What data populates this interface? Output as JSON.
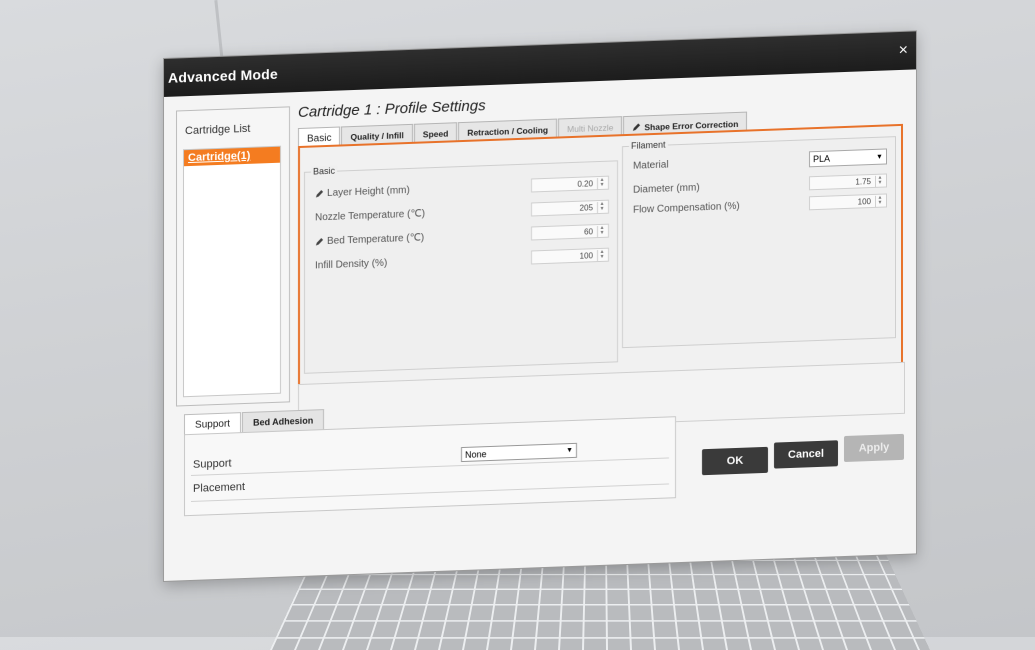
{
  "window": {
    "title": "Advanced Mode",
    "close_glyph": "×"
  },
  "cartridge_list": {
    "header": "Cartridge List",
    "items": [
      "Cartridge(1)"
    ]
  },
  "profile": {
    "title": "Cartridge 1 : Profile Settings"
  },
  "tabs": [
    "Basic",
    "Quality / Infill",
    "Speed",
    "Retraction / Cooling",
    "Multi Nozzle",
    "Shape Error Correction"
  ],
  "basic_group": {
    "label": "Basic",
    "rows": [
      {
        "label": "Layer Height (mm)",
        "value": "0.20",
        "icon": "pencil-icon"
      },
      {
        "label": "Nozzle Temperature (℃)",
        "value": "205"
      },
      {
        "label": "Bed Temperature (℃)",
        "value": "60",
        "icon": "pencil-icon"
      },
      {
        "label": "Infill Density (%)",
        "value": "100"
      }
    ]
  },
  "filament_group": {
    "label": "Filament",
    "material_label": "Material",
    "material_value": "PLA",
    "diameter_label": "Diameter (mm)",
    "diameter_value": "1.75",
    "flow_label": "Flow Compensation (%)",
    "flow_value": "100"
  },
  "support_tabs": [
    "Support",
    "Bed Adhesion"
  ],
  "support": {
    "label": "Support",
    "placement_label": "Placement",
    "select_value": "None"
  },
  "buttons": {
    "ok": "OK",
    "cancel": "Cancel",
    "apply": "Apply"
  },
  "colors": {
    "accent": "#f47c20",
    "titlebar": "#1c1c1c",
    "button": "#3a3a3a"
  }
}
